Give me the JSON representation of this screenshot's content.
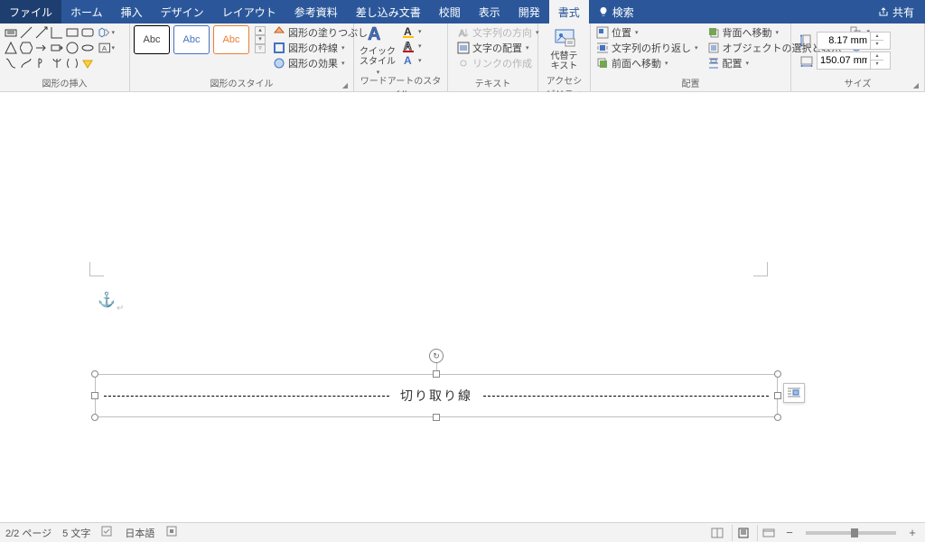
{
  "tabs": {
    "file": "ファイル",
    "home": "ホーム",
    "insert": "挿入",
    "design": "デザイン",
    "layout": "レイアウト",
    "references": "参考資料",
    "mailings": "差し込み文書",
    "review": "校閲",
    "view": "表示",
    "developer": "開発",
    "format": "書式",
    "search": "検索",
    "share": "共有"
  },
  "ribbon": {
    "g1_label": "図形の挿入",
    "g2_label": "図形のスタイル",
    "style_sample": "Abc",
    "fill": "図形の塗りつぶし",
    "outline": "図形の枠線",
    "effects": "図形の効果",
    "g3_label": "ワードアートのスタイル",
    "quick": "クイック",
    "style": "スタイル",
    "g4_label": "テキスト",
    "text_dir": "文字列の方向",
    "align_text": "文字の配置",
    "link": "リンクの作成",
    "g5_label": "アクセシビリティ",
    "alt1": "代替テ",
    "alt2": "キスト",
    "g6_label": "配置",
    "pos": "位置",
    "wrap": "文字列の折り返し",
    "fwd": "前面へ移動",
    "back": "背面へ移動",
    "selpane": "オブジェクトの選択と表示",
    "align": "配置",
    "g7_label": "サイズ",
    "height": "8.17 mm",
    "width": "150.07 mm"
  },
  "doc": {
    "textbox_label": "切り取り線"
  },
  "status": {
    "page": "2/2 ページ",
    "words": "5 文字",
    "lang": "日本語",
    "zoom": "100%"
  }
}
